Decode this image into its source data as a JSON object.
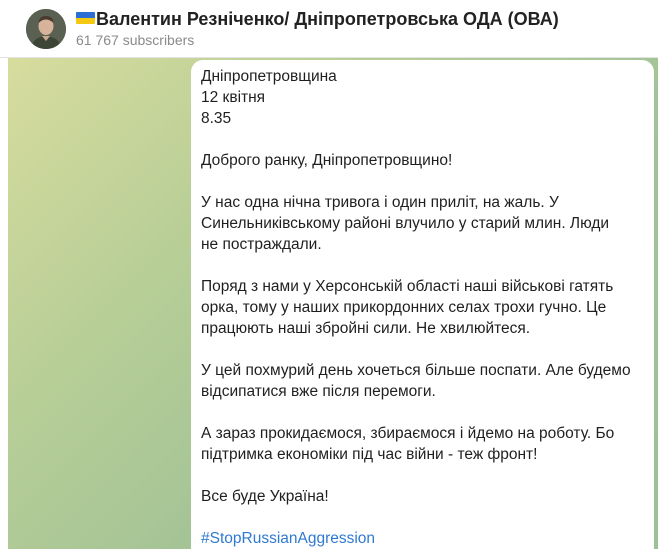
{
  "channel": {
    "flag_icon": "ukraine-flag-icon",
    "title": "Валентин Резніченко/ Дніпропетровська ОДА (ОВА)",
    "subscribers": "61 767 subscribers"
  },
  "colors": {
    "link": "#2f7ad1",
    "background_green": "#a3c396"
  },
  "message": {
    "lines": [
      "Дніпропетровщина",
      "12 квітня",
      "8.35",
      "",
      "Доброго ранку, Дніпропетровщино!",
      "",
      "У нас одна нічна тривога і один приліт, на жаль. У",
      "Синельниківському районі влучило у старий млин. Люди",
      "не постраждали.",
      "",
      "Поряд з нами у Херсонській області наші військові гатять",
      "орка, тому у наших прикордонних селах трохи гучно. Це",
      "працюють наші збройні сили. Не хвилюйтеся.",
      "",
      "У цей похмурий день хочеться більше поспати. Але будемо",
      "відсипатися  вже після перемоги.",
      "",
      "А зараз прокидаємося, збираємося і йдемо на роботу. Бо",
      "підтримка економіки під час війни - теж фронт!",
      "",
      "Все буде Україна!",
      ""
    ],
    "hashtag": "#StopRussianAggression"
  }
}
